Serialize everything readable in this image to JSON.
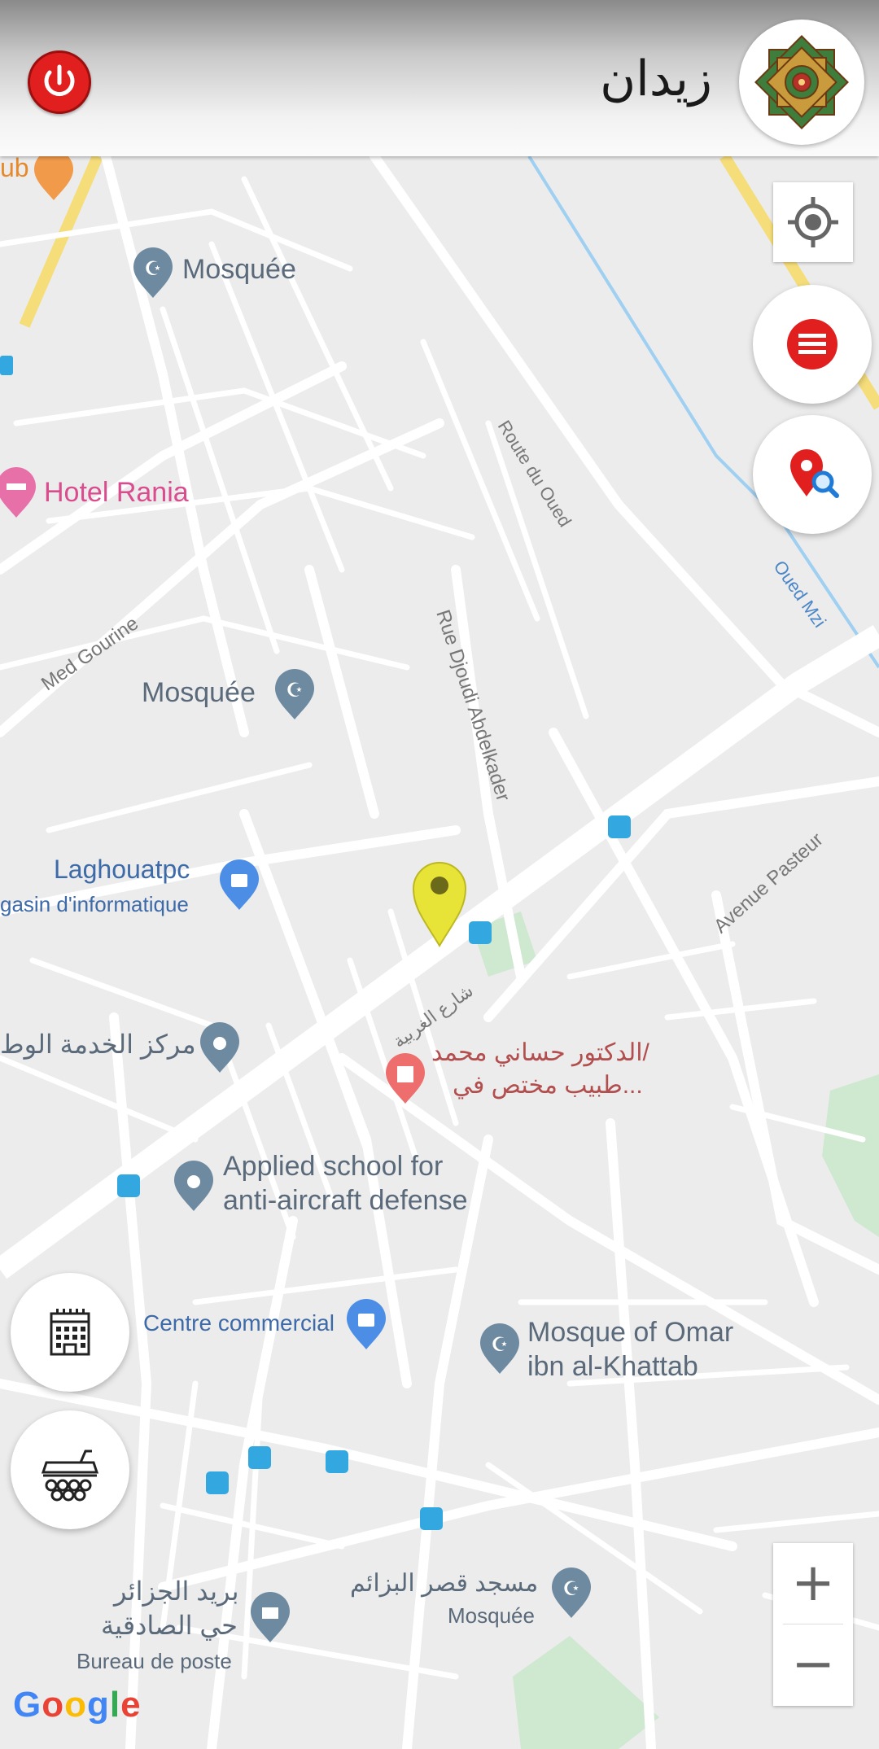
{
  "header": {
    "title": "زيدان"
  },
  "map": {
    "poi_labels": {
      "ub_fragment": "ub",
      "mosque_north": "Mosquée",
      "hotel_rania": "Hotel Rania",
      "mosque_mid": "Mosquée",
      "laghouatpc": "Laghouatpc",
      "laghouatpc_sub": "gasin d'informatique",
      "service_center": "مركز الخدمة الوط",
      "doctor_line1": "الدكتور حساني محمد/",
      "doctor_line2": "طبيب مختص في...",
      "applied_school_1": "Applied school for",
      "applied_school_2": "anti-aircraft defense",
      "centre_commercial": "Centre commercial",
      "mosque_omar_1": "Mosque of Omar",
      "mosque_omar_2": "ibn al-Khattab",
      "post_ar1": "بريد الجزائر",
      "post_ar2": "حي الصادقية",
      "post_fr": "Bureau de poste",
      "mosque_qasr_ar": "مسجد قصر البزائم",
      "mosque_qasr_fr": "Mosquée"
    },
    "streets": {
      "route_du_oued": "Route du Oued",
      "oued_mzi": "Oued Mzi",
      "med_gourine": "Med Gourine",
      "rue_djoudi": "Rue Djoudi Abdelkader",
      "avenue_pasteur": "Avenue Pasteur",
      "sharia_gharbia": "شارع الغربية"
    },
    "attribution": "Google"
  },
  "controls": {
    "zoom_in": "+",
    "zoom_out": "−",
    "icons": {
      "power": "power-icon",
      "location": "my-location-icon",
      "list": "list-icon",
      "search_location": "search-location-icon",
      "building": "building-icon",
      "vehicle": "vehicle-icon"
    }
  },
  "colors": {
    "header_red": "#e11f1f",
    "marker_yellow": "#e8e337",
    "map_bg": "#ececec",
    "road": "#ffffff"
  }
}
